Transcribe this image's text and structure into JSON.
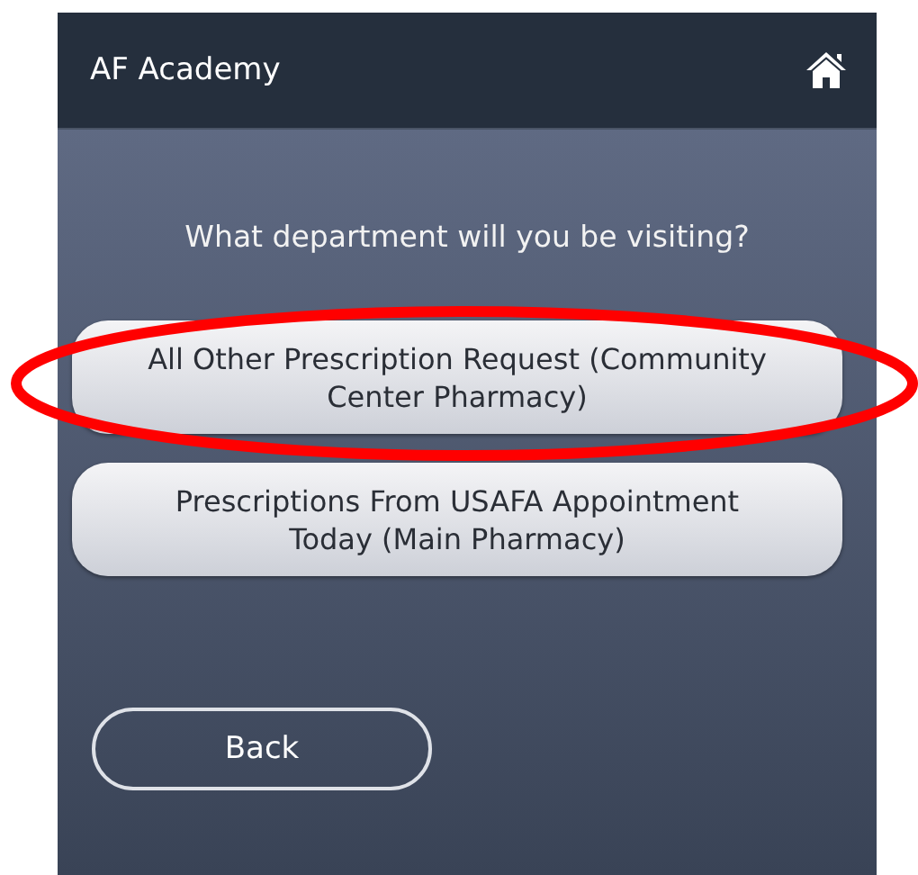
{
  "header": {
    "title": "AF Academy"
  },
  "question": "What department will you be visiting?",
  "options": [
    {
      "label": "All Other Prescription Request (Community Center Pharmacy)",
      "circled": true
    },
    {
      "label": "Prescriptions From USAFA Appointment Today (Main Pharmacy)",
      "circled": false
    }
  ],
  "back_button": "Back"
}
